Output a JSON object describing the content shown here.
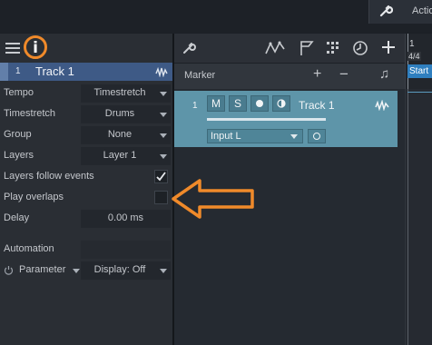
{
  "topbar": {
    "action_label": "Actio"
  },
  "inspector": {
    "info_label": "i",
    "track": {
      "number": "1",
      "name": "Track 1"
    },
    "rows": [
      {
        "label": "Tempo",
        "value": "Timestretch"
      },
      {
        "label": "Timestretch",
        "value": "Drums"
      },
      {
        "label": "Group",
        "value": "None"
      },
      {
        "label": "Layers",
        "value": "Layer 1"
      },
      {
        "label": "Layers follow events",
        "checked": true
      },
      {
        "label": "Play overlaps",
        "checked": false
      },
      {
        "label": "Delay",
        "value": "0.00 ms"
      }
    ],
    "automation_label": "Automation",
    "parameter_label": "Parameter",
    "display_value": "Display: Off"
  },
  "arrangement": {
    "marker_label": "Marker",
    "ruler": {
      "bar": "1",
      "signature": "4/4",
      "start_label": "Start"
    },
    "track": {
      "number": "1",
      "mute": "M",
      "solo": "S",
      "name": "Track 1",
      "input": "Input L",
      "color": "#5e95a9"
    }
  },
  "colors": {
    "annotation": "#f08a2a",
    "track_selected": "#3e5a86"
  }
}
